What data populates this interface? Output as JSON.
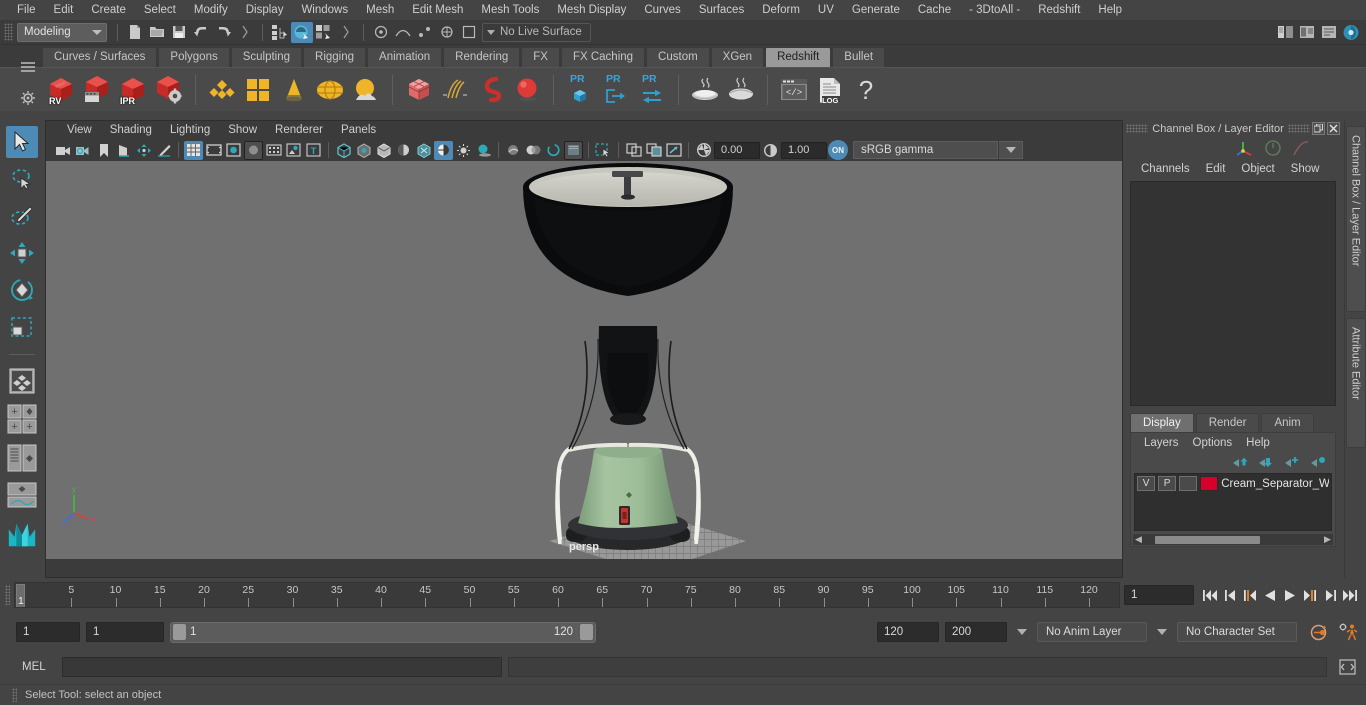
{
  "app": {
    "menus": [
      "File",
      "Edit",
      "Create",
      "Select",
      "Modify",
      "Display",
      "Windows",
      "Mesh",
      "Edit Mesh",
      "Mesh Tools",
      "Mesh Display",
      "Curves",
      "Surfaces",
      "Deform",
      "UV",
      "Generate",
      "Cache",
      "- 3DtoAll -",
      "Redshift",
      "Help"
    ]
  },
  "status_line": {
    "mode": "Modeling",
    "live_surface": "No Live Surface"
  },
  "shelf": {
    "tabs": [
      "Curves / Surfaces",
      "Polygons",
      "Sculpting",
      "Rigging",
      "Animation",
      "Rendering",
      "FX",
      "FX Caching",
      "Custom",
      "XGen",
      "Redshift",
      "Bullet"
    ],
    "active_tab": "Redshift",
    "buttons": [
      {
        "name": "redshift-render-view",
        "label": "RV"
      },
      {
        "name": "redshift-render-sequence",
        "label": ""
      },
      {
        "name": "redshift-ipr",
        "label": "IPR"
      },
      {
        "name": "redshift-render-settings",
        "label": ""
      },
      {
        "name": "redshift-lights",
        "label": ""
      },
      {
        "name": "redshift-area-light",
        "label": ""
      },
      {
        "name": "redshift-spot-light",
        "label": ""
      },
      {
        "name": "redshift-dome-light",
        "label": ""
      },
      {
        "name": "redshift-environment",
        "label": ""
      },
      {
        "name": "redshift-proxy-cube",
        "label": ""
      },
      {
        "name": "redshift-hair",
        "label": ""
      },
      {
        "name": "redshift-volume",
        "label": ""
      },
      {
        "name": "redshift-sphere",
        "label": ""
      },
      {
        "name": "redshift-proxy-create",
        "label": "PR"
      },
      {
        "name": "redshift-proxy-export",
        "label": "PR"
      },
      {
        "name": "redshift-proxy-swap",
        "label": "PR"
      },
      {
        "name": "redshift-bake",
        "label": ""
      },
      {
        "name": "redshift-bake-all",
        "label": ""
      },
      {
        "name": "redshift-script-editor",
        "label": ""
      },
      {
        "name": "redshift-log",
        "label": ".LOG"
      },
      {
        "name": "redshift-help",
        "label": "?"
      }
    ]
  },
  "viewport": {
    "menus": [
      "View",
      "Shading",
      "Lighting",
      "Show",
      "Renderer",
      "Panels"
    ],
    "exposure": "0.00",
    "gamma_value": "1.00",
    "color_toggle": "ON",
    "color_profile": "sRGB gamma",
    "camera_label": "persp",
    "axis": {
      "x": "x",
      "y": "y",
      "z": "z"
    }
  },
  "channel_box": {
    "title": "Channel Box / Layer Editor",
    "menus": [
      "Channels",
      "Edit",
      "Object",
      "Show"
    ]
  },
  "layer_editor": {
    "tabs": [
      "Display",
      "Render",
      "Anim"
    ],
    "active_tab": "Display",
    "menus": [
      "Layers",
      "Options",
      "Help"
    ],
    "layers": [
      {
        "visible": "V",
        "playback": "P",
        "type": "",
        "color": "#d6002a",
        "name": "Cream_Separator_With"
      }
    ]
  },
  "side_tabs": [
    "Channel Box / Layer Editor",
    "Attribute Editor"
  ],
  "timeline": {
    "ticks": [
      5,
      10,
      15,
      20,
      25,
      30,
      35,
      40,
      45,
      50,
      55,
      60,
      65,
      70,
      75,
      80,
      85,
      90,
      95,
      100,
      105,
      110,
      115,
      120
    ],
    "start": 1,
    "end": 120,
    "current_frame": "1",
    "cursor_label": "1"
  },
  "range_slider": {
    "anim_start": "1",
    "range_start": "1",
    "slider_min": "1",
    "slider_max": "120",
    "range_end": "120",
    "anim_end": "200",
    "anim_layer": "No Anim Layer",
    "character_set": "No Character Set"
  },
  "command_line": {
    "language": "MEL",
    "input_value": "",
    "output_value": ""
  },
  "help_line": {
    "message": "Select Tool: select an object"
  },
  "colors": {
    "accent_blue": "#4d8ab5",
    "accent_orange": "#e07c24",
    "layer_red": "#d6002a",
    "bg": "#444444",
    "viewport_bg": "#707070"
  },
  "toolbox": [
    {
      "name": "select-tool",
      "active": true
    },
    {
      "name": "lasso-select-tool",
      "active": false
    },
    {
      "name": "paint-select-tool",
      "active": false
    },
    {
      "name": "move-tool",
      "active": false
    },
    {
      "name": "rotate-tool",
      "active": false
    },
    {
      "name": "scale-tool",
      "active": false
    },
    {
      "name": "last-tool",
      "active": false
    }
  ]
}
